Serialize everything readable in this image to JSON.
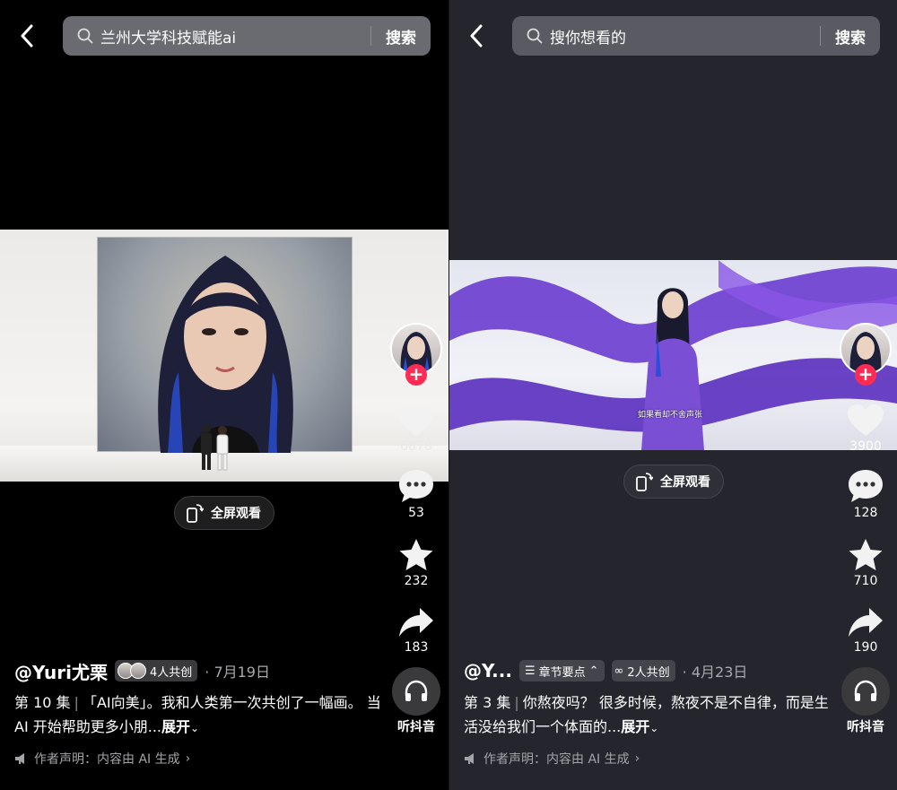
{
  "colors": {
    "accent_red": "#fe2c55",
    "left_bg": "#000000",
    "right_bg": "#25262d"
  },
  "left": {
    "search": {
      "query": "兰州大学科技赋能ai",
      "button": "搜索"
    },
    "fullscreen_label": "全屏观看",
    "rail": {
      "likes": "6878",
      "comments": "53",
      "favorites": "232",
      "shares": "183",
      "listen_label": "听抖音"
    },
    "info": {
      "author": "@Yuri尤栗",
      "co_create": "4人共创",
      "date": "· 7月19日",
      "episode": "第 10 集",
      "desc_text": "「AI向美」。我和人类第一次共创了一幅画。 当 AI 开始帮助更多小朋...",
      "expand": "展开",
      "declaration": "作者声明：内容由 AI 生成"
    }
  },
  "right": {
    "search": {
      "placeholder": "搜你想看的",
      "button": "搜索"
    },
    "subtitle": "如果看却不舍声张",
    "fullscreen_label": "全屏观看",
    "rail": {
      "likes": "3900",
      "comments": "128",
      "favorites": "710",
      "shares": "190",
      "listen_label": "听抖音"
    },
    "info": {
      "author": "@Y...",
      "chapter": "章节要点",
      "co_create": "2人共创",
      "date": "· 4月23日",
      "episode": "第 3 集",
      "desc_text": "你熬夜吗？ 很多时候，熬夜不是不自律，而是生活没给我们一个体面的...",
      "expand": "展开",
      "declaration": "作者声明：内容由 AI 生成"
    }
  }
}
